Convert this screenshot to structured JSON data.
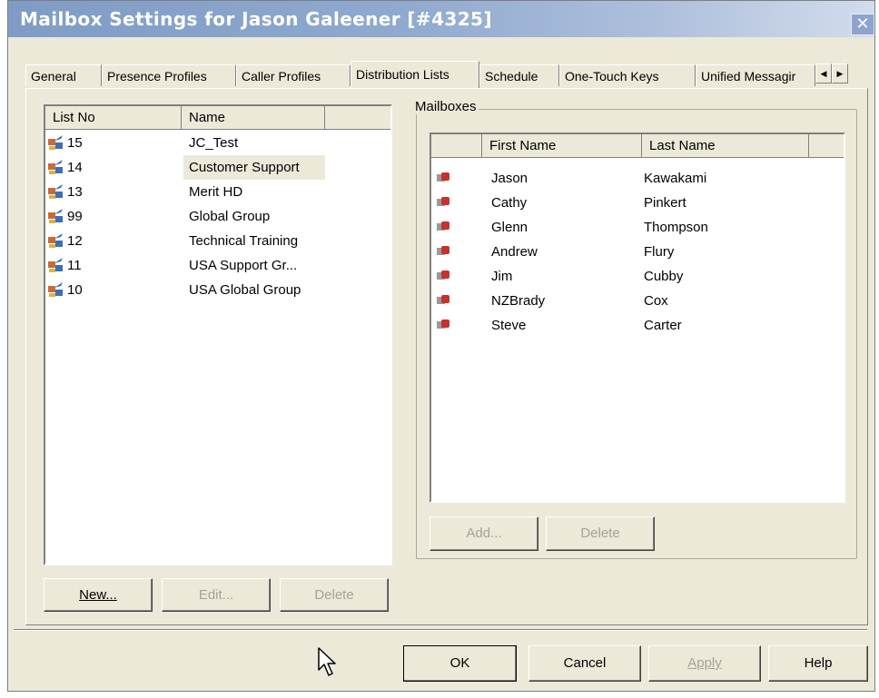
{
  "window": {
    "title": "Mailbox Settings for Jason Galeener [#4325]"
  },
  "tabs": [
    {
      "label": "General"
    },
    {
      "label": "Presence Profiles"
    },
    {
      "label": "Caller Profiles"
    },
    {
      "label": "Distribution Lists",
      "active": true
    },
    {
      "label": "Schedule"
    },
    {
      "label": "One-Touch Keys"
    },
    {
      "label": "Unified Messagir"
    }
  ],
  "distribution_lists": {
    "columns": {
      "list_no": "List No",
      "name": "Name"
    },
    "rows": [
      {
        "list_no": "15",
        "name": "JC_Test"
      },
      {
        "list_no": "14",
        "name": "Customer Support",
        "selected": true
      },
      {
        "list_no": "13",
        "name": "Merit HD"
      },
      {
        "list_no": "99",
        "name": "Global Group"
      },
      {
        "list_no": "12",
        "name": "Technical Training"
      },
      {
        "list_no": "11",
        "name": "USA Support Gr..."
      },
      {
        "list_no": "10",
        "name": "USA Global Group"
      }
    ],
    "buttons": {
      "new": "New...",
      "edit": "Edit...",
      "delete": "Delete"
    }
  },
  "mailboxes": {
    "label": "Mailboxes",
    "columns": {
      "first_name": "First Name",
      "last_name": "Last Name"
    },
    "rows": [
      {
        "first": "Jason",
        "last": "Kawakami"
      },
      {
        "first": "Cathy",
        "last": "Pinkert"
      },
      {
        "first": "Glenn",
        "last": "Thompson"
      },
      {
        "first": "Andrew",
        "last": "Flury"
      },
      {
        "first": "Jim",
        "last": "Cubby"
      },
      {
        "first": "NZBrady",
        "last": "Cox"
      },
      {
        "first": "Steve",
        "last": "Carter"
      }
    ],
    "buttons": {
      "add": "Add...",
      "delete": "Delete"
    }
  },
  "footer": {
    "ok": "OK",
    "cancel": "Cancel",
    "apply": "Apply",
    "help": "Help"
  },
  "icons": {
    "close": "close-icon",
    "scroll_left": "arrow-left-icon",
    "scroll_right": "arrow-right-icon",
    "list": "distribution-list-icon",
    "mailbox": "mailbox-icon",
    "cursor": "mouse-cursor-icon"
  },
  "colors": {
    "title_bar": "#8fa9cf",
    "dialog_bg": "#ece9d8",
    "selected_row": "#ece9d8"
  }
}
